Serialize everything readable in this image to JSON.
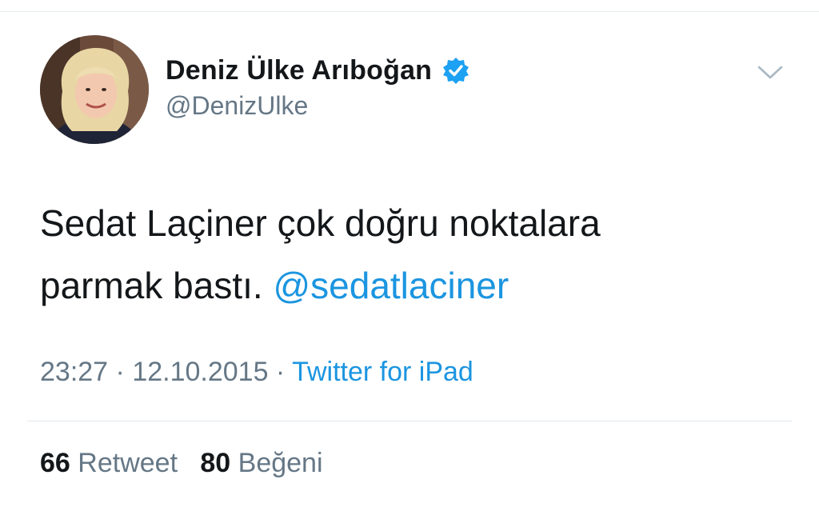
{
  "author": {
    "display_name": "Deniz Ülke Arıboğan",
    "handle": "@DenizUlke",
    "verified": true
  },
  "tweet": {
    "text_line1": "Sedat Laçiner çok doğru noktalara",
    "text_line2_prefix": "parmak bastı. ",
    "mention": "@sedatlaciner"
  },
  "meta": {
    "time": "23:27",
    "separator": " · ",
    "date": "12.10.2015",
    "source": "Twitter for iPad"
  },
  "stats": {
    "retweet_count": "66",
    "retweet_label": "Retweet",
    "like_count": "80",
    "like_label": "Beğeni"
  },
  "icons": {
    "verified": "verified-badge-icon",
    "menu": "chevron-down-icon"
  },
  "colors": {
    "text": "#14171a",
    "muted": "#657786",
    "link": "#1b95e0",
    "verified": "#1da1f2"
  }
}
